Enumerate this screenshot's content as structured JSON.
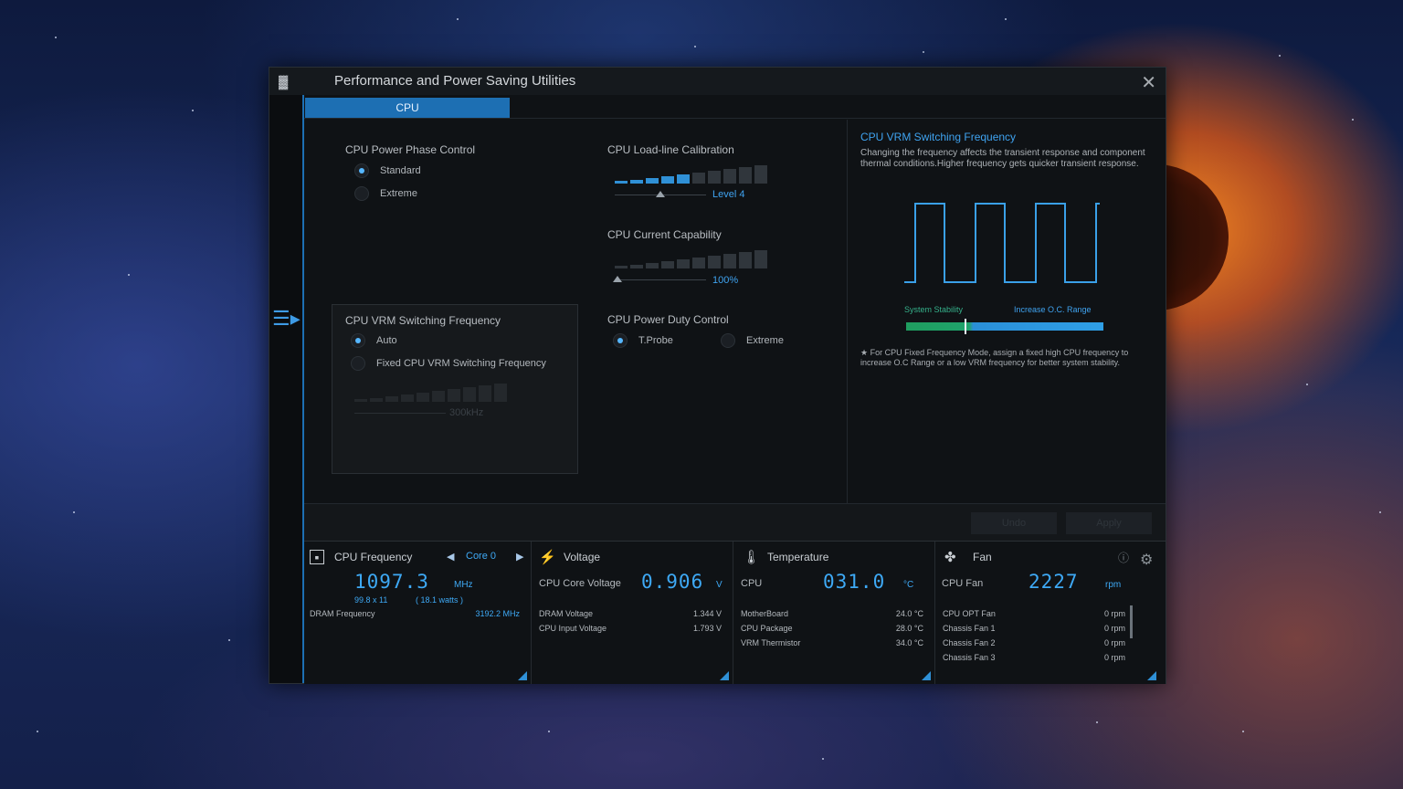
{
  "window": {
    "title": "Performance and Power Saving Utilities",
    "close_glyph": "✕",
    "logo_glyph": "▓"
  },
  "tabs": [
    {
      "label": "CPU",
      "active": true
    }
  ],
  "sidebar": {
    "menu_glyph": "☰▸"
  },
  "phase_control": {
    "title": "CPU Power Phase Control",
    "options": [
      "Standard",
      "Extreme"
    ],
    "selected": "Standard"
  },
  "vrm": {
    "title": "CPU VRM Switching Frequency",
    "options": [
      "Auto",
      "Fixed CPU VRM Switching Frequency"
    ],
    "selected": "Auto",
    "value": "300kHz"
  },
  "llc": {
    "title": "CPU Load-line Calibration",
    "value": "Level 4",
    "level_fraction": 0.4
  },
  "current": {
    "title": "CPU Current Capability",
    "value": "100%",
    "level_fraction": 0.0
  },
  "duty": {
    "title": "CPU Power Duty Control",
    "options": [
      "T.Probe",
      "Extreme"
    ],
    "selected": "T.Probe"
  },
  "help": {
    "title": "CPU VRM Switching Frequency",
    "text": "Changing the frequency affects the transient response and component thermal conditions.Higher frequency gets quicker transient response.",
    "left_label": "System Stability",
    "right_label": "Increase O.C. Range",
    "note": "★ For CPU Fixed Frequency Mode, assign a fixed high CPU frequency to increase O.C Range or a low VRM frequency for better system stability."
  },
  "actions": {
    "undo_label": "Undo",
    "apply_label": "Apply"
  },
  "cpu_freq": {
    "title": "CPU Frequency",
    "core_label": "Core 0",
    "value": "1097.3",
    "unit": "MHz",
    "ratio": "99.8  x  11",
    "watts": "( 18.1   watts )",
    "dram_label": "DRAM Frequency",
    "dram_value": "3192.2  MHz"
  },
  "voltage": {
    "title": "Voltage",
    "label": "CPU Core Voltage",
    "value": "0.906",
    "unit": "V",
    "rows": [
      {
        "name": "DRAM Voltage",
        "value": "1.344  V"
      },
      {
        "name": "CPU Input Voltage",
        "value": "1.793  V"
      }
    ]
  },
  "temperature": {
    "title": "Temperature",
    "label": "CPU",
    "value": "031.0",
    "unit": "°C",
    "rows": [
      {
        "name": "MotherBoard",
        "value": "24.0 °C"
      },
      {
        "name": "CPU Package",
        "value": "28.0 °C"
      },
      {
        "name": "VRM Thermistor",
        "value": "34.0 °C"
      }
    ]
  },
  "fan": {
    "title": "Fan",
    "label": "CPU Fan",
    "value": "2227",
    "unit": "rpm",
    "rows": [
      {
        "name": "CPU OPT Fan",
        "value": "0  rpm"
      },
      {
        "name": "Chassis Fan 1",
        "value": "0  rpm"
      },
      {
        "name": "Chassis Fan 2",
        "value": "0  rpm"
      },
      {
        "name": "Chassis Fan 3",
        "value": "0  rpm"
      }
    ]
  },
  "colors": {
    "accent": "#2f90d6",
    "readout": "#3ea9f5",
    "green": "#1f9d5f"
  }
}
